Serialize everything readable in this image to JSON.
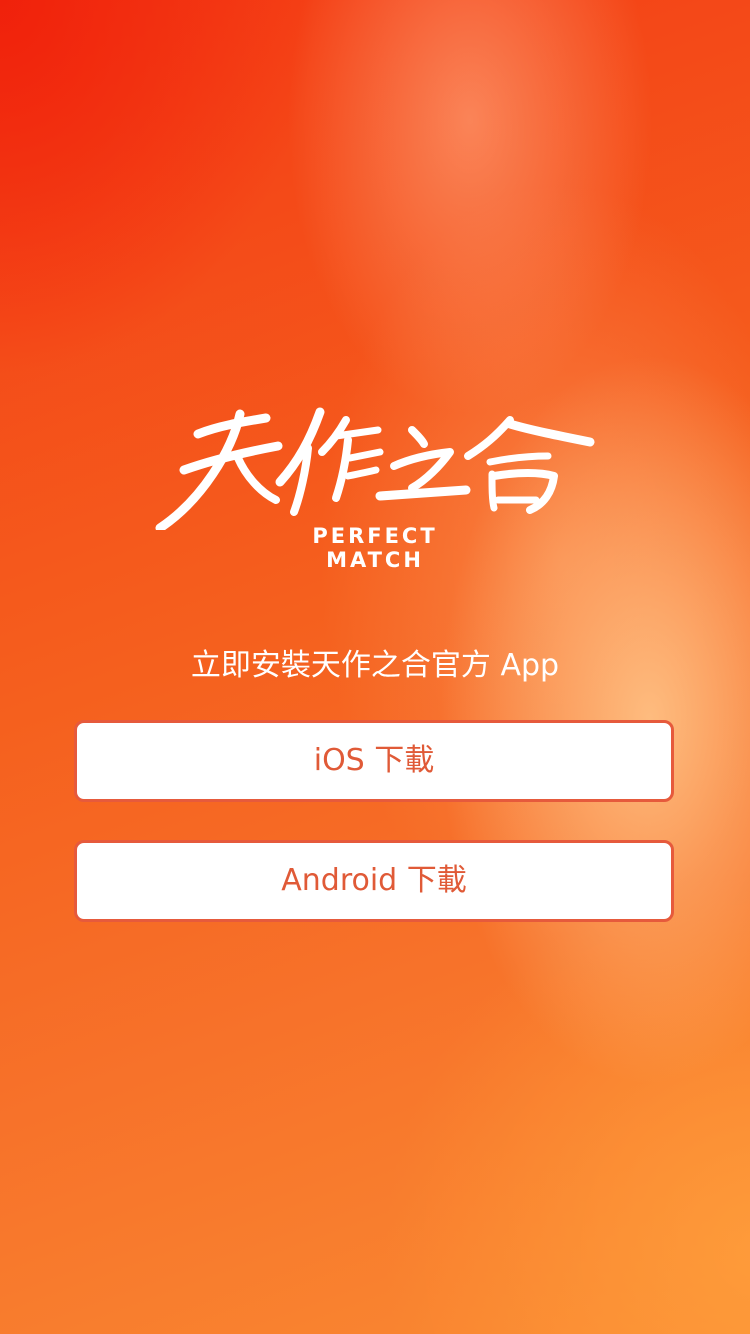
{
  "brand": {
    "logo_script": "天作之合",
    "logo_sub": "PERFECT MATCH"
  },
  "tagline": "立即安裝天作之合官方 App",
  "buttons": {
    "ios_label": "iOS 下載",
    "android_label": "Android 下載"
  },
  "colors": {
    "button_text": "#e05a37",
    "button_border": "#e65a3c",
    "button_bg": "#ffffff"
  }
}
